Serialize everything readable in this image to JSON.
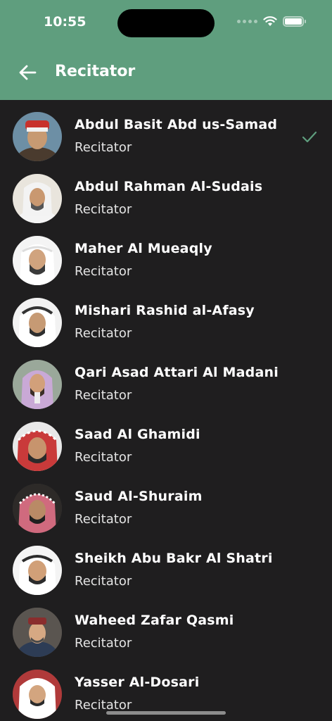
{
  "status_bar": {
    "time": "10:55"
  },
  "header": {
    "title": "Recitator",
    "back_icon": "arrow-left-icon"
  },
  "accent_color": "#5f9e7e",
  "reciters": [
    {
      "name": "Abdul Basit Abd us-Samad",
      "subtitle": "Recitator",
      "selected": true
    },
    {
      "name": "Abdul Rahman Al-Sudais",
      "subtitle": "Recitator",
      "selected": false
    },
    {
      "name": "Maher Al Mueaqly",
      "subtitle": "Recitator",
      "selected": false
    },
    {
      "name": "Mishari Rashid al-Afasy",
      "subtitle": "Recitator",
      "selected": false
    },
    {
      "name": "Qari Asad Attari Al Madani",
      "subtitle": "Recitator",
      "selected": false
    },
    {
      "name": "Saad Al Ghamidi",
      "subtitle": "Recitator",
      "selected": false
    },
    {
      "name": "Saud Al-Shuraim",
      "subtitle": "Recitator",
      "selected": false
    },
    {
      "name": "Sheikh Abu Bakr Al Shatri",
      "subtitle": "Recitator",
      "selected": false
    },
    {
      "name": "Waheed Zafar Qasmi",
      "subtitle": "Recitator",
      "selected": false
    },
    {
      "name": "Yasser Al-Dosari",
      "subtitle": "Recitator",
      "selected": false
    }
  ]
}
